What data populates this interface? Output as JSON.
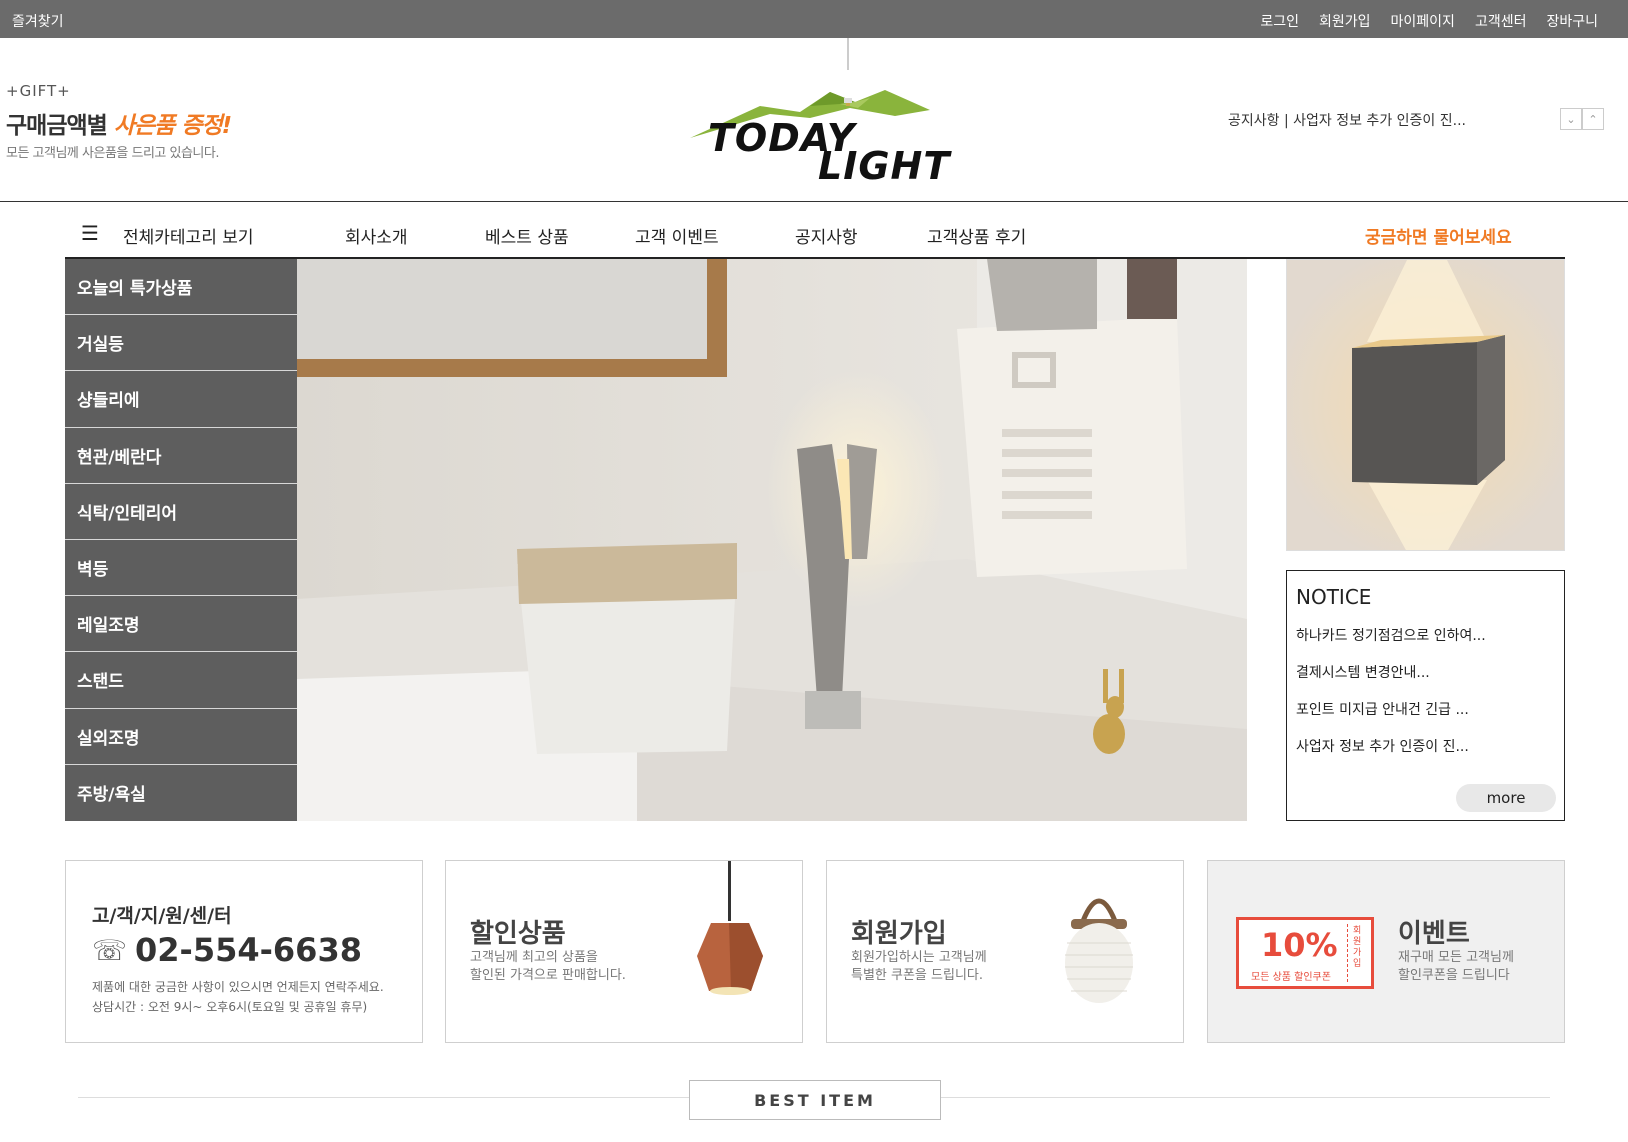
{
  "topbar": {
    "favorites": "즐겨찾기",
    "links": [
      "로그인",
      "회원가입",
      "마이페이지",
      "고객센터",
      "장바구니"
    ]
  },
  "gift": {
    "tag": "+GIFT+",
    "headline_prefix": "구매금액별",
    "headline_accent": "사은품 증정!",
    "sub": "모든 고객님께 사은품을 드리고 있습니다."
  },
  "logo": {
    "line1": "TODAY",
    "line2": "LIGHT"
  },
  "ticker": {
    "text": "공지사항 | 사업자 정보 추가 인증이 진..."
  },
  "nav": {
    "all_categories": "전체카테고리 보기",
    "items": [
      "회사소개",
      "베스트 상품",
      "고객 이벤트",
      "공지사항",
      "고객상품 후기"
    ],
    "ask": "궁금하면 물어보세요"
  },
  "categories": [
    "오늘의 특가상품",
    "거실등",
    "샹들리에",
    "현관/베란다",
    "식탁/인테리어",
    "벽등",
    "레일조명",
    "스탠드",
    "실외조명",
    "주방/욕실"
  ],
  "notice": {
    "title": "NOTICE",
    "items": [
      "하나카드 정기점검으로 인하여...",
      "결제시스템 변경안내...",
      "포인트 미지급 안내건 긴급 ...",
      "사업자 정보 추가 인증이 진..."
    ],
    "more": "more"
  },
  "banners": {
    "support": {
      "title": "고/객/지/원/센/터",
      "phone": "02-554-6638",
      "desc1": "제품에 대한 궁금한 사항이 있으시면 언제든지 연락주세요.",
      "desc2": "상담시간 : 오전 9시~ 오후6시(토요일 및 공휴일 휴무)"
    },
    "sale": {
      "title": "할인상품",
      "desc1": "고객님께 최고의 상품을",
      "desc2": "할인된 가격으로 판매합니다."
    },
    "join": {
      "title": "회원가입",
      "desc1": "회원가입하시는 고객님께",
      "desc2": "특별한 쿠폰을 드립니다."
    },
    "event": {
      "title": "이벤트",
      "desc1": "재구매 모든 고객님께",
      "desc2": "할인쿠폰을 드립니다",
      "coupon_pct": "10%",
      "coupon_text": "모든 상품 할인쿠폰",
      "coupon_side": "회원가입"
    }
  },
  "best_item": "BEST ITEM",
  "colors": {
    "accent": "#f07a24",
    "topbar": "#6b6b6b",
    "sidebar": "#5e5e5e",
    "logo_green": "#8ab43c",
    "coupon_red": "#e74c3c"
  }
}
